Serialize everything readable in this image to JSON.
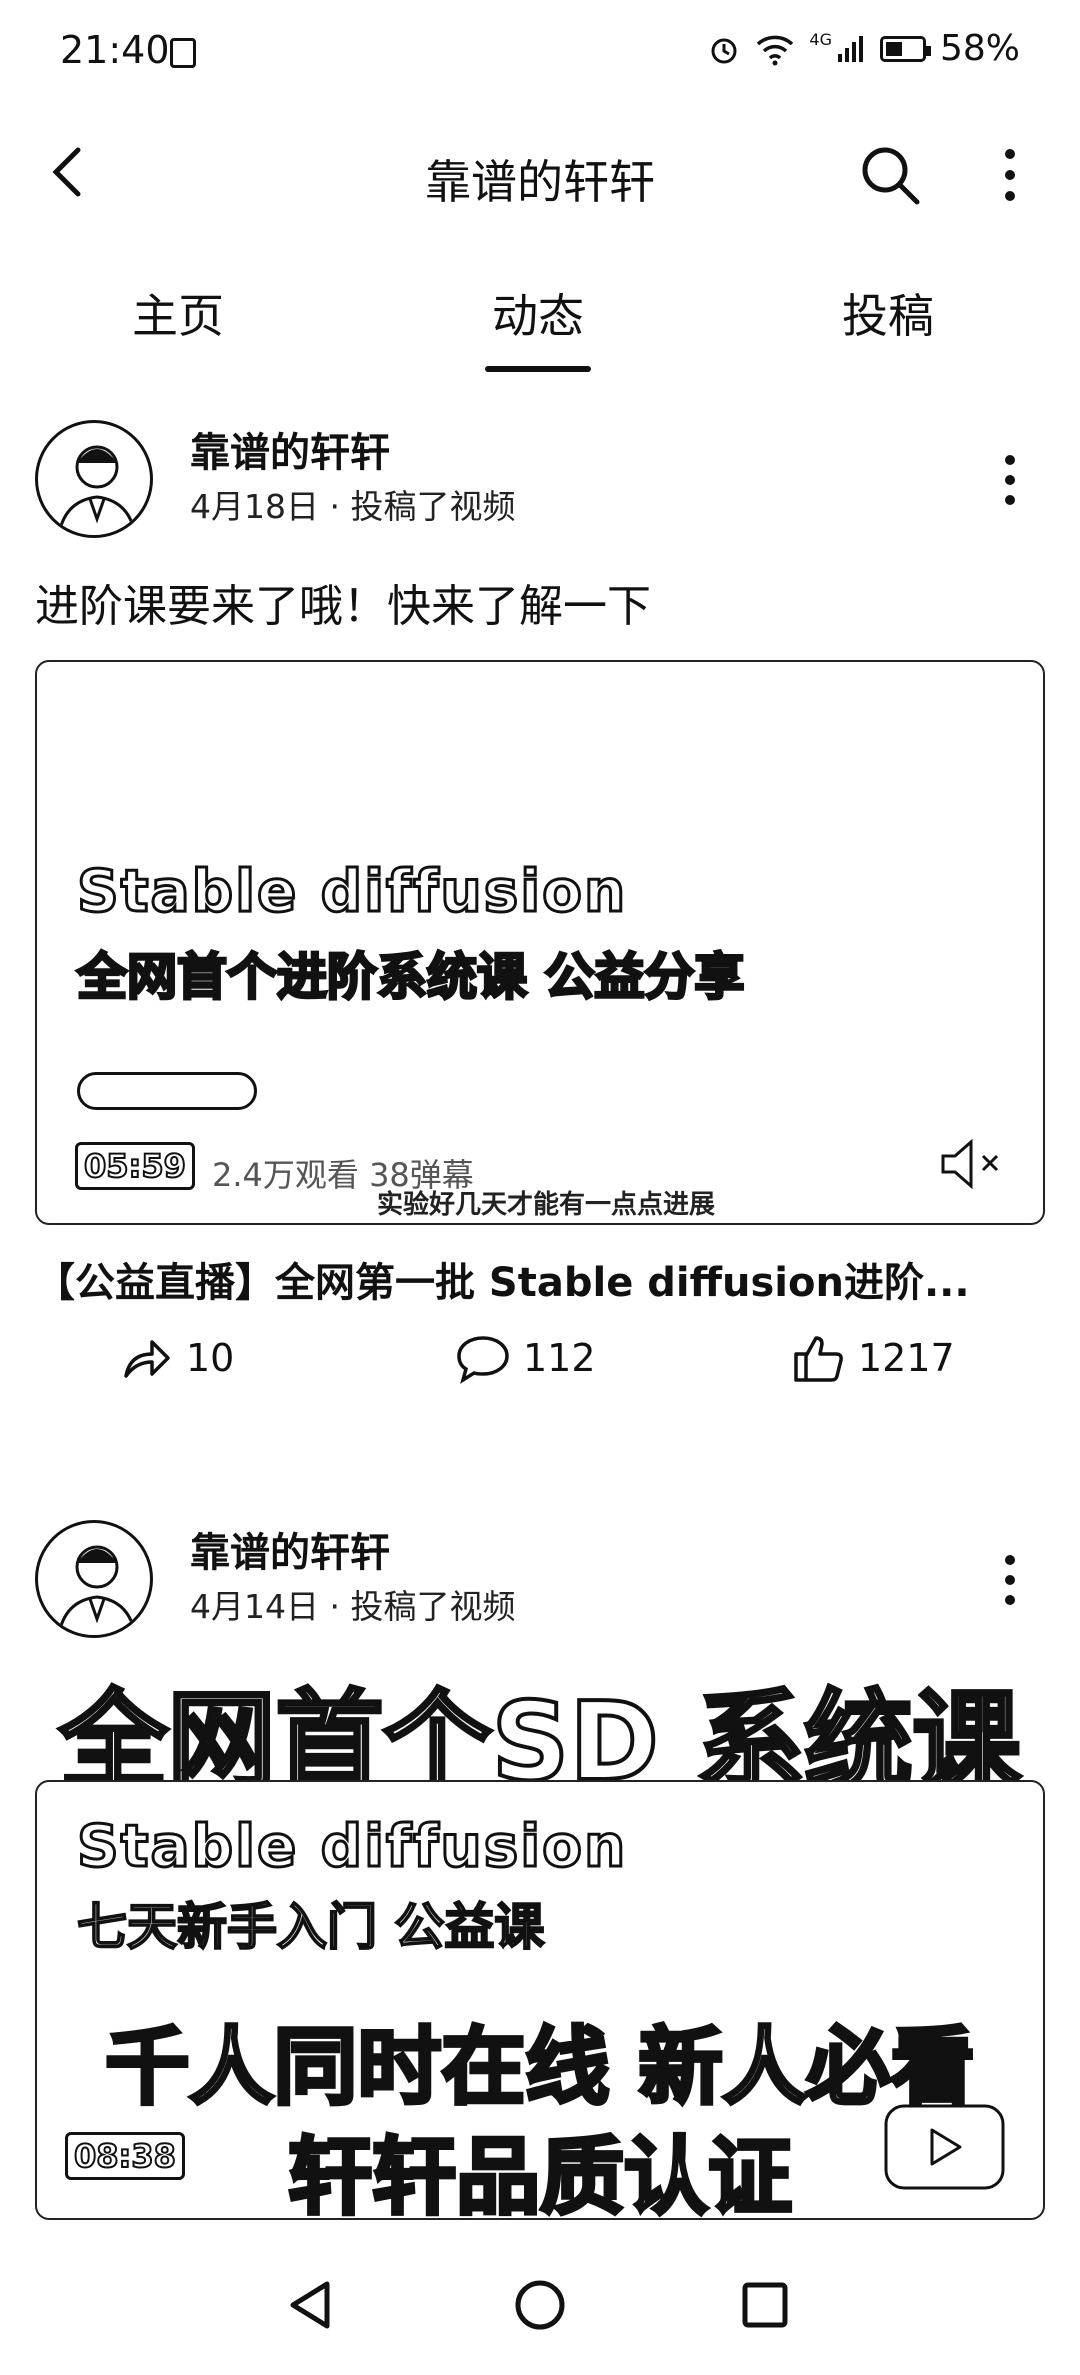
{
  "status": {
    "time": "21:40",
    "signal": "4G",
    "battery": "58%"
  },
  "header": {
    "title": "靠谱的轩轩"
  },
  "tabs": [
    {
      "label": "主页"
    },
    {
      "label": "动态"
    },
    {
      "label": "投稿"
    }
  ],
  "active_tab": "动态",
  "posts": [
    {
      "author": "靠谱的轩轩",
      "meta": "4月18日 · 投稿了视频",
      "text": "进阶课要来了哦！快来了解一下",
      "video": {
        "line_en": "Stable diffusion",
        "line_cn": "全网首个进阶系统课 公益分享",
        "duration": "05:59",
        "stats": "2.4万观看  38弹幕",
        "caption": "实验好几天才能有一点点进展"
      },
      "video_title": "【公益直播】全网第一批 Stable diffusion进阶...",
      "shares": "10",
      "comments": "112",
      "likes": "1217"
    },
    {
      "author": "靠谱的轩轩",
      "meta": "4月14日 · 投稿了视频",
      "video": {
        "banner_top": "全网首个SD 系统课",
        "line_en": "Stable diffusion",
        "line_cn": "七天新手入门 公益课",
        "banner_mid": "千人同时在线  新人必看",
        "banner_bottom": "轩轩品质认证",
        "duration": "08:38"
      }
    }
  ]
}
